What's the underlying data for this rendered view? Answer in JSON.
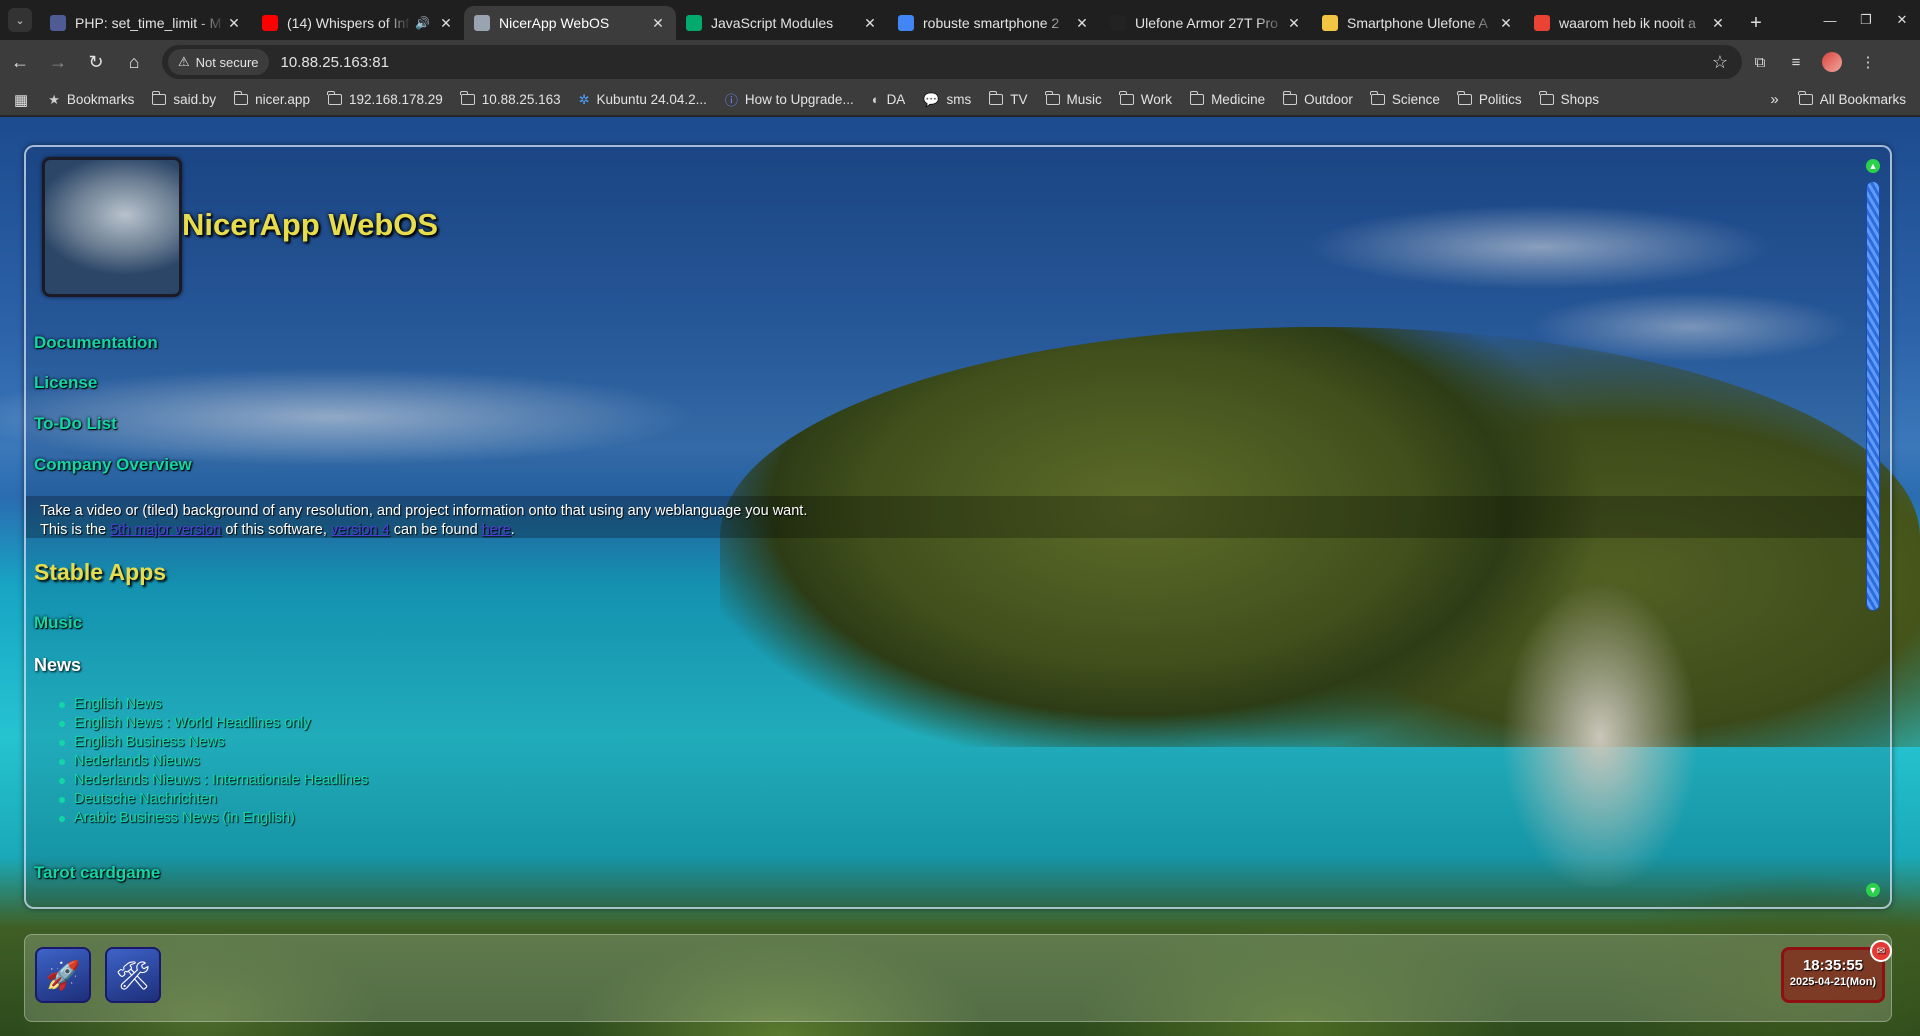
{
  "browser": {
    "tabs": [
      {
        "title": "PHP: set_time_limit - M",
        "favicon": "php-favicon",
        "color": "#4f5b93",
        "active": false,
        "audio": false
      },
      {
        "title": "(14) Whispers of Inf",
        "favicon": "youtube-favicon",
        "color": "#ff0000",
        "active": false,
        "audio": true
      },
      {
        "title": "NicerApp WebOS",
        "favicon": "nicerapp-favicon",
        "color": "#9aa4b0",
        "active": true,
        "audio": false
      },
      {
        "title": "JavaScript Modules",
        "favicon": "w3schools-favicon",
        "color": "#04aa6d",
        "active": false,
        "audio": false
      },
      {
        "title": "robuste smartphone 2",
        "favicon": "google-favicon",
        "color": "#4285f4",
        "active": false,
        "audio": false
      },
      {
        "title": "Ulefone Armor 27T Pro",
        "favicon": "amazon-favicon",
        "color": "#222222",
        "active": false,
        "audio": false
      },
      {
        "title": "Smartphone Ulefone A",
        "favicon": "shop-favicon",
        "color": "#f4c542",
        "active": false,
        "audio": false
      },
      {
        "title": "waarom heb ik nooit a",
        "favicon": "gmail-favicon",
        "color": "#ea4335",
        "active": false,
        "audio": false
      }
    ],
    "security_label": "Not secure",
    "url": "10.88.25.163:81",
    "bookmarks": [
      {
        "label": "Bookmarks",
        "icon": "star-icon"
      },
      {
        "label": "said.by",
        "icon": "folder-icon"
      },
      {
        "label": "nicer.app",
        "icon": "folder-icon"
      },
      {
        "label": "192.168.178.29",
        "icon": "folder-icon"
      },
      {
        "label": "10.88.25.163",
        "icon": "folder-icon"
      },
      {
        "label": "Kubuntu 24.04.2...",
        "icon": "kubuntu-icon"
      },
      {
        "label": "How to Upgrade...",
        "icon": "info-icon"
      },
      {
        "label": "DA",
        "icon": "github-icon"
      },
      {
        "label": "sms",
        "icon": "chat-icon"
      },
      {
        "label": "TV",
        "icon": "folder-icon"
      },
      {
        "label": "Music",
        "icon": "folder-icon"
      },
      {
        "label": "Work",
        "icon": "folder-icon"
      },
      {
        "label": "Medicine",
        "icon": "folder-icon"
      },
      {
        "label": "Outdoor",
        "icon": "folder-icon"
      },
      {
        "label": "Science",
        "icon": "folder-icon"
      },
      {
        "label": "Politics",
        "icon": "folder-icon"
      },
      {
        "label": "Shops",
        "icon": "folder-icon"
      }
    ],
    "all_bookmarks_label": "All Bookmarks"
  },
  "page": {
    "site_title": "NicerApp WebOS",
    "menu": {
      "documentation": "Documentation",
      "license": "License",
      "todo": "To-Do List",
      "company": "Company Overview"
    },
    "intro": {
      "line1": "Take a video or (tiled) background of any resolution, and project information onto that using any weblanguage you want.",
      "line2_a": "This is the ",
      "link_major": "5th major version",
      "line2_b": " of this software, ",
      "link_v4": "version 4",
      "line2_c": " can be found ",
      "link_here": "here",
      "line2_d": "."
    },
    "stable_apps_title": "Stable Apps",
    "music_link": "Music",
    "news_title": "News",
    "news_items": [
      "English News",
      "English News : World Headlines only",
      "English Business News",
      "Nederlands Nieuws",
      "Nederlands Nieuws : Internationale Headlines",
      "Deutsche Nachrichten",
      "Arabic Business News (in English)"
    ],
    "tarot_link": "Tarot cardgame",
    "colors": {
      "heading": "#e7dc4c",
      "link": "#13d6a6",
      "inline_link": "#4b3fd6",
      "clock_border": "#8e1010"
    }
  },
  "taskbar": {
    "apps": [
      {
        "icon": "rocket-icon",
        "glyph": "🚀"
      },
      {
        "icon": "tools-icon",
        "glyph": "🛠"
      }
    ],
    "clock_time": "18:35:55",
    "clock_date": "2025-04-21(Mon)"
  }
}
